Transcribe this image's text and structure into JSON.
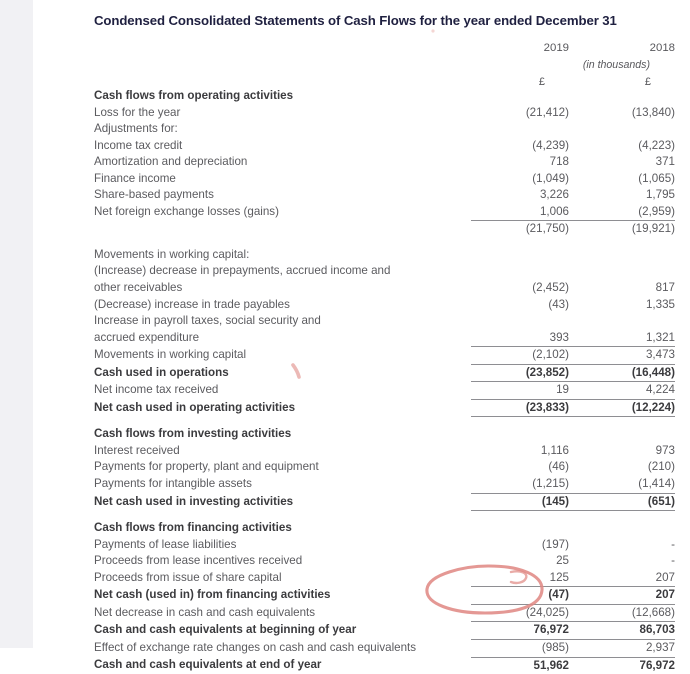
{
  "document": {
    "title": "Condensed Consolidated Statements of Cash Flows for the year ended December 31",
    "columns": {
      "year_current": "2019",
      "year_prior": "2018",
      "units_note": "(in thousands)",
      "currency_current": "£",
      "currency_prior": "£"
    }
  },
  "rows": [
    {
      "label": "Cash flows from operating activities",
      "v2019": "",
      "v2018": "",
      "bold": true
    },
    {
      "label": "Loss for the year",
      "v2019": "(21,412)",
      "v2018": "(13,840)",
      "bold": false
    },
    {
      "label": "Adjustments for:",
      "v2019": "",
      "v2018": "",
      "bold": false
    },
    {
      "label": "Income tax credit",
      "v2019": "(4,239)",
      "v2018": "(4,223)",
      "bold": false
    },
    {
      "label": "Amortization and depreciation",
      "v2019": "718",
      "v2018": "371",
      "bold": false
    },
    {
      "label": "Finance income",
      "v2019": "(1,049)",
      "v2018": "(1,065)",
      "bold": false
    },
    {
      "label": "Share-based payments",
      "v2019": "3,226",
      "v2018": "1,795",
      "bold": false
    },
    {
      "label": "Net foreign exchange losses (gains)",
      "v2019": "1,006",
      "v2018": "(2,959)",
      "bold": false
    },
    {
      "label": "",
      "v2019": "(21,750)",
      "v2018": "(19,921)",
      "bold": false,
      "rule_top": true
    },
    {
      "label": "Movements in working capital:",
      "v2019": "",
      "v2018": "",
      "bold": false,
      "gap_before": true
    },
    {
      "label": "(Increase) decrease in prepayments, accrued income and",
      "v2019": "",
      "v2018": "",
      "bold": false
    },
    {
      "label": "other receivables",
      "v2019": "(2,452)",
      "v2018": "817",
      "bold": false
    },
    {
      "label": "(Decrease) increase in trade payables",
      "v2019": "(43)",
      "v2018": "1,335",
      "bold": false
    },
    {
      "label": "Increase in payroll taxes, social security and",
      "v2019": "",
      "v2018": "",
      "bold": false
    },
    {
      "label": "accrued expenditure",
      "v2019": "393",
      "v2018": "1,321",
      "bold": false
    },
    {
      "label": "Movements in working capital",
      "v2019": "(2,102)",
      "v2018": "3,473",
      "bold": false,
      "rule_top": true
    },
    {
      "label": "Cash used in operations",
      "v2019": "(23,852)",
      "v2018": "(16,448)",
      "bold": true,
      "rule_top": true
    },
    {
      "label": "Net income tax received",
      "v2019": "19",
      "v2018": "4,224",
      "bold": false,
      "rule_top": true
    },
    {
      "label": "Net cash used in operating activities",
      "v2019": "(23,833)",
      "v2018": "(12,224)",
      "bold": true,
      "rule_top": true,
      "rule_bottom": true
    },
    {
      "label": "Cash flows from investing activities",
      "v2019": "",
      "v2018": "",
      "bold": true,
      "gap_before": true
    },
    {
      "label": "Interest received",
      "v2019": "1,116",
      "v2018": "973",
      "bold": false
    },
    {
      "label": "Payments for property, plant and equipment",
      "v2019": "(46)",
      "v2018": "(210)",
      "bold": false
    },
    {
      "label": "Payments for intangible assets",
      "v2019": "(1,215)",
      "v2018": "(1,414)",
      "bold": false
    },
    {
      "label": "Net cash used in investing activities",
      "v2019": "(145)",
      "v2018": "(651)",
      "bold": true,
      "rule_top": true,
      "rule_bottom": true
    },
    {
      "label": "Cash flows from financing activities",
      "v2019": "",
      "v2018": "",
      "bold": true,
      "gap_before": true
    },
    {
      "label": "Payments of lease liabilities",
      "v2019": "(197)",
      "v2018": "-",
      "bold": false
    },
    {
      "label": "Proceeds from lease incentives received",
      "v2019": "25",
      "v2018": "-",
      "bold": false
    },
    {
      "label": "Proceeds from issue of share capital",
      "v2019": "125",
      "v2018": "207",
      "bold": false
    },
    {
      "label": "Net cash (used in) from financing activities",
      "v2019": "(47)",
      "v2018": "207",
      "bold": true,
      "rule_top": true
    },
    {
      "label": "Net decrease in cash and cash equivalents",
      "v2019": "(24,025)",
      "v2018": "(12,668)",
      "bold": false,
      "rule_top": true
    },
    {
      "label": "Cash and cash equivalents at beginning of year",
      "v2019": "76,972",
      "v2018": "86,703",
      "bold": true,
      "rule_top": true
    },
    {
      "label": "Effect of exchange rate changes on cash and cash equivalents",
      "v2019": "(985)",
      "v2018": "2,937",
      "bold": false,
      "rule_top": true
    },
    {
      "label": "Cash and cash equivalents at end of year",
      "v2019": "51,962",
      "v2018": "76,972",
      "bold": true,
      "rule_top": true
    }
  ],
  "annotations": {
    "ink_color": "#e08a85",
    "ellipse": {
      "name": "red-ellipse-highlight",
      "encircles": [
        "(47)",
        "(24,025)",
        "76,972"
      ]
    },
    "smudge": {
      "name": "red-ink-smudge"
    }
  }
}
